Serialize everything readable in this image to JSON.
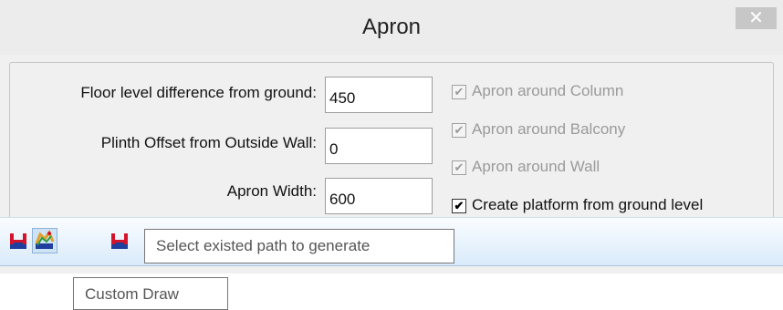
{
  "dialog": {
    "title": "Apron",
    "close_glyph": "✕"
  },
  "fields": {
    "floor_level": {
      "label": "Floor level difference from ground:",
      "value": "450"
    },
    "plinth_offset": {
      "label": "Plinth Offset from Outside Wall:",
      "value": "0"
    },
    "apron_width": {
      "label": "Apron Width:",
      "value": "600"
    }
  },
  "checkboxes": [
    {
      "label": "Apron around Column",
      "checked": true,
      "enabled": false
    },
    {
      "label": "Apron around Balcony",
      "checked": true,
      "enabled": false
    },
    {
      "label": "Apron around Wall",
      "checked": true,
      "enabled": false
    },
    {
      "label": "Create platform from ground level",
      "checked": true,
      "enabled": true
    }
  ],
  "checkmark_glyph": "✔",
  "toolbar": {
    "buttons": [
      {
        "icon": "draw-path-icon",
        "pressed": false
      },
      {
        "icon": "select-existing-path-icon",
        "pressed": true
      },
      {
        "icon": "custom-draw-icon",
        "pressed": false
      }
    ]
  },
  "tooltips": {
    "select_path": "Select existed path to generate",
    "custom_draw": "Custom Draw"
  },
  "colors": {
    "icon_red": "#d4142a",
    "icon_blue": "#1e3f9e",
    "toolbar_gradient_bottom": "#d9ebfb"
  }
}
